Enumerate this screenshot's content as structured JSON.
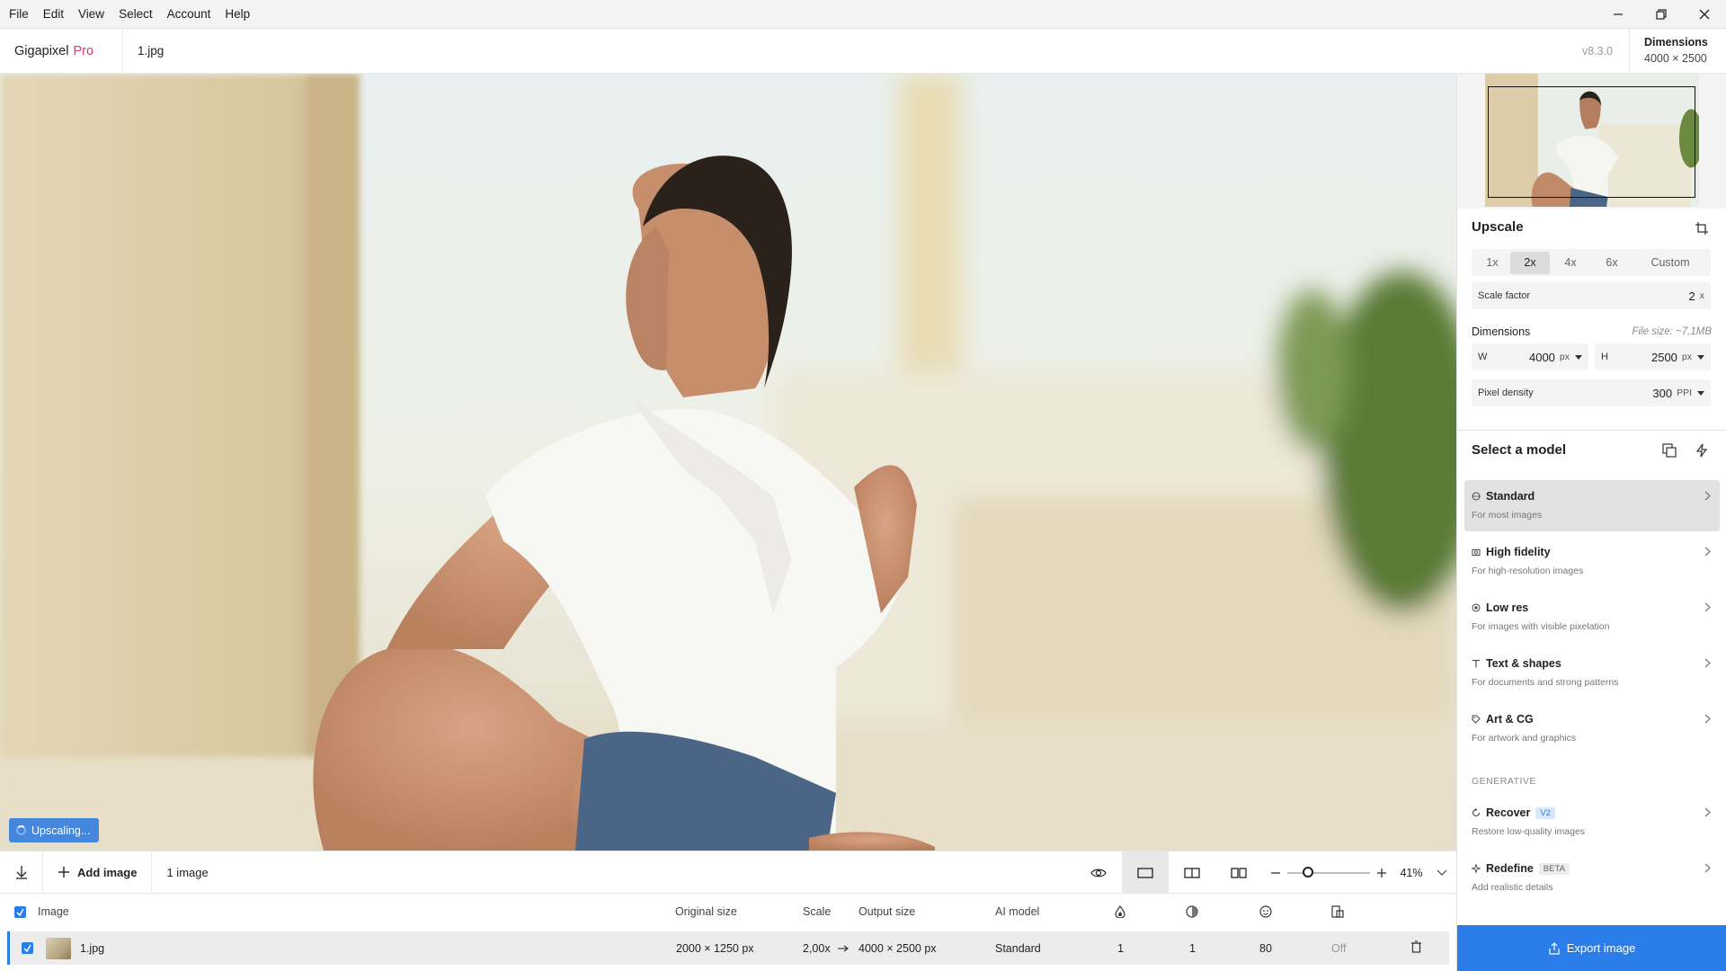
{
  "menu": [
    "File",
    "Edit",
    "View",
    "Select",
    "Account",
    "Help"
  ],
  "header": {
    "brand": "Gigapixel",
    "brand_tier": "Pro",
    "file_tab": "1.jpg",
    "version": "v8.3.0",
    "dimensions_label": "Dimensions",
    "dimensions_value": "4000 × 2500"
  },
  "canvas": {
    "status": "Upscaling..."
  },
  "toolbar": {
    "add_label": "Add image",
    "count_label": "1 image",
    "zoom_value": "41%",
    "zoom_fraction": 0.41
  },
  "table": {
    "headers": {
      "image": "Image",
      "original": "Original size",
      "scale": "Scale",
      "output": "Output size",
      "model": "AI model"
    },
    "rows": [
      {
        "name": "1.jpg",
        "original": "2000 × 1250 px",
        "scale": "2,00x",
        "output": "4000 × 2500 px",
        "model": "Standard",
        "v1": "1",
        "v2": "1",
        "v3": "80",
        "v4": "Off"
      }
    ]
  },
  "upscale": {
    "title": "Upscale",
    "options": [
      "1x",
      "2x",
      "4x",
      "6x",
      "Custom"
    ],
    "selected": "2x",
    "scale_factor_label": "Scale factor",
    "scale_factor_value": "2",
    "scale_factor_unit": "x",
    "dimensions_label": "Dimensions",
    "file_size": "File size: ~7,1MB",
    "width_label": "W",
    "width_value": "4000",
    "width_unit": "px",
    "height_label": "H",
    "height_value": "2500",
    "height_unit": "px",
    "density_label": "Pixel density",
    "density_value": "300",
    "density_unit": "PPI"
  },
  "models": {
    "title": "Select a model",
    "items": [
      {
        "name": "Standard",
        "desc": "For most images",
        "icon": "globe-icon"
      },
      {
        "name": "High fidelity",
        "desc": "For high-resolution images",
        "icon": "camera-icon"
      },
      {
        "name": "Low res",
        "desc": "For images with visible pixelation",
        "icon": "pixel-icon"
      },
      {
        "name": "Text & shapes",
        "desc": "For documents and strong patterns",
        "icon": "text-icon"
      },
      {
        "name": "Art & CG",
        "desc": "For artwork and graphics",
        "icon": "tag-icon"
      }
    ],
    "generative_label": "GENERATIVE",
    "generative": [
      {
        "name": "Recover",
        "badge": "V2",
        "desc": "Restore low-quality images",
        "icon": "recover-icon"
      },
      {
        "name": "Redefine",
        "badge": "BETA",
        "desc": "Add realistic details",
        "icon": "sparkle-icon"
      }
    ]
  },
  "export_label": "Export image",
  "colors": {
    "accent": "#2b7de9",
    "brand_pro": "#e8336a",
    "selected_bg": "#e1e1e1"
  }
}
